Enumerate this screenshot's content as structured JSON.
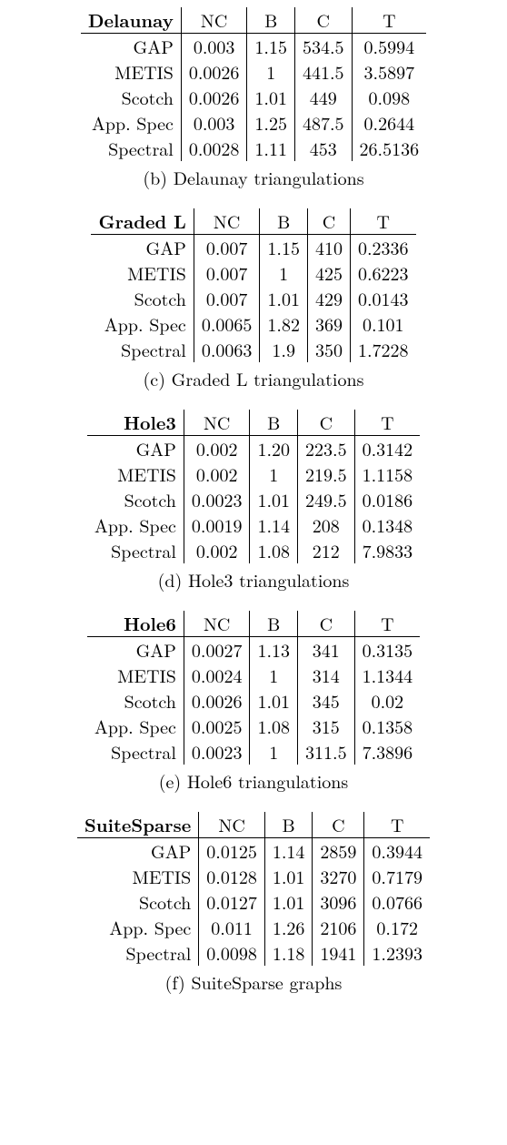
{
  "columns": [
    "NC",
    "B",
    "C",
    "T"
  ],
  "row_names": [
    "GAP",
    "METIS",
    "Scotch",
    "App. Spec",
    "Spectral"
  ],
  "tables": [
    {
      "label": "Delaunay",
      "caption_tag": "(b)",
      "caption_text": "Delaunay triangulations",
      "rows": [
        [
          "0.003",
          "1.15",
          "534.5",
          "0.5994"
        ],
        [
          "0.0026",
          "1",
          "441.5",
          "3.5897"
        ],
        [
          "0.0026",
          "1.01",
          "449",
          "0.098"
        ],
        [
          "0.003",
          "1.25",
          "487.5",
          "0.2644"
        ],
        [
          "0.0028",
          "1.11",
          "453",
          "26.5136"
        ]
      ]
    },
    {
      "label": "Graded L",
      "caption_tag": "(c)",
      "caption_text": "Graded L triangulations",
      "rows": [
        [
          "0.007",
          "1.15",
          "410",
          "0.2336"
        ],
        [
          "0.007",
          "1",
          "425",
          "0.6223"
        ],
        [
          "0.007",
          "1.01",
          "429",
          "0.0143"
        ],
        [
          "0.0065",
          "1.82",
          "369",
          "0.101"
        ],
        [
          "0.0063",
          "1.9",
          "350",
          "1.7228"
        ]
      ]
    },
    {
      "label": "Hole3",
      "caption_tag": "(d)",
      "caption_text": "Hole3 triangulations",
      "rows": [
        [
          "0.002",
          "1.20",
          "223.5",
          "0.3142"
        ],
        [
          "0.002",
          "1",
          "219.5",
          "1.1158"
        ],
        [
          "0.0023",
          "1.01",
          "249.5",
          "0.0186"
        ],
        [
          "0.0019",
          "1.14",
          "208",
          "0.1348"
        ],
        [
          "0.002",
          "1.08",
          "212",
          "7.9833"
        ]
      ]
    },
    {
      "label": "Hole6",
      "caption_tag": "(e)",
      "caption_text": "Hole6 triangulations",
      "rows": [
        [
          "0.0027",
          "1.13",
          "341",
          "0.3135"
        ],
        [
          "0.0024",
          "1",
          "314",
          "1.1344"
        ],
        [
          "0.0026",
          "1.01",
          "345",
          "0.02"
        ],
        [
          "0.0025",
          "1.08",
          "315",
          "0.1358"
        ],
        [
          "0.0023",
          "1",
          "311.5",
          "7.3896"
        ]
      ]
    },
    {
      "label": "SuiteSparse",
      "caption_tag": "(f)",
      "caption_text": "SuiteSparse graphs",
      "rows": [
        [
          "0.0125",
          "1.14",
          "2859",
          "0.3944"
        ],
        [
          "0.0128",
          "1.01",
          "3270",
          "0.7179"
        ],
        [
          "0.0127",
          "1.01",
          "3096",
          "0.0766"
        ],
        [
          "0.011",
          "1.26",
          "2106",
          "0.172"
        ],
        [
          "0.0098",
          "1.18",
          "1941",
          "1.2393"
        ]
      ]
    }
  ]
}
